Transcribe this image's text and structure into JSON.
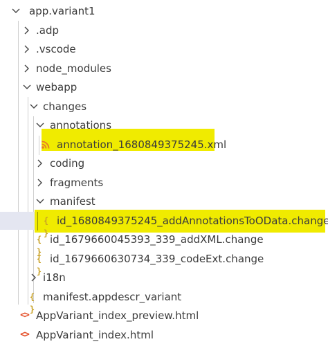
{
  "explorer": {
    "highlight_color": "#f0eb00",
    "selection_color": "#e4e6f1",
    "items": [
      {
        "label": "app.variant1",
        "expanded": true
      },
      {
        "label": ".adp",
        "expanded": false
      },
      {
        "label": ".vscode",
        "expanded": false
      },
      {
        "label": "node_modules",
        "expanded": false
      },
      {
        "label": "webapp",
        "expanded": true
      },
      {
        "label": "changes",
        "expanded": true
      },
      {
        "label": "annotations",
        "expanded": true
      },
      {
        "label": "annotation_1680849375245.xml",
        "icon": "rss-icon",
        "highlighted": true
      },
      {
        "label": "coding",
        "expanded": false
      },
      {
        "label": "fragments",
        "expanded": false
      },
      {
        "label": "manifest",
        "expanded": true
      },
      {
        "label": "id_1680849375245_addAnnotationsToOData.change",
        "icon": "json-braces-icon",
        "highlighted": true,
        "selected": true
      },
      {
        "label": "id_1679660045393_339_addXML.change",
        "icon": "json-braces-icon"
      },
      {
        "label": "id_1679660630734_339_codeExt.change",
        "icon": "json-braces-icon"
      },
      {
        "label": "i18n",
        "expanded": false
      },
      {
        "label": "manifest.appdescr_variant",
        "icon": "json-braces-icon"
      },
      {
        "label": "AppVariant_index_preview.html",
        "icon": "html-code-icon"
      },
      {
        "label": "AppVariant_index.html",
        "icon": "html-code-icon"
      }
    ]
  }
}
